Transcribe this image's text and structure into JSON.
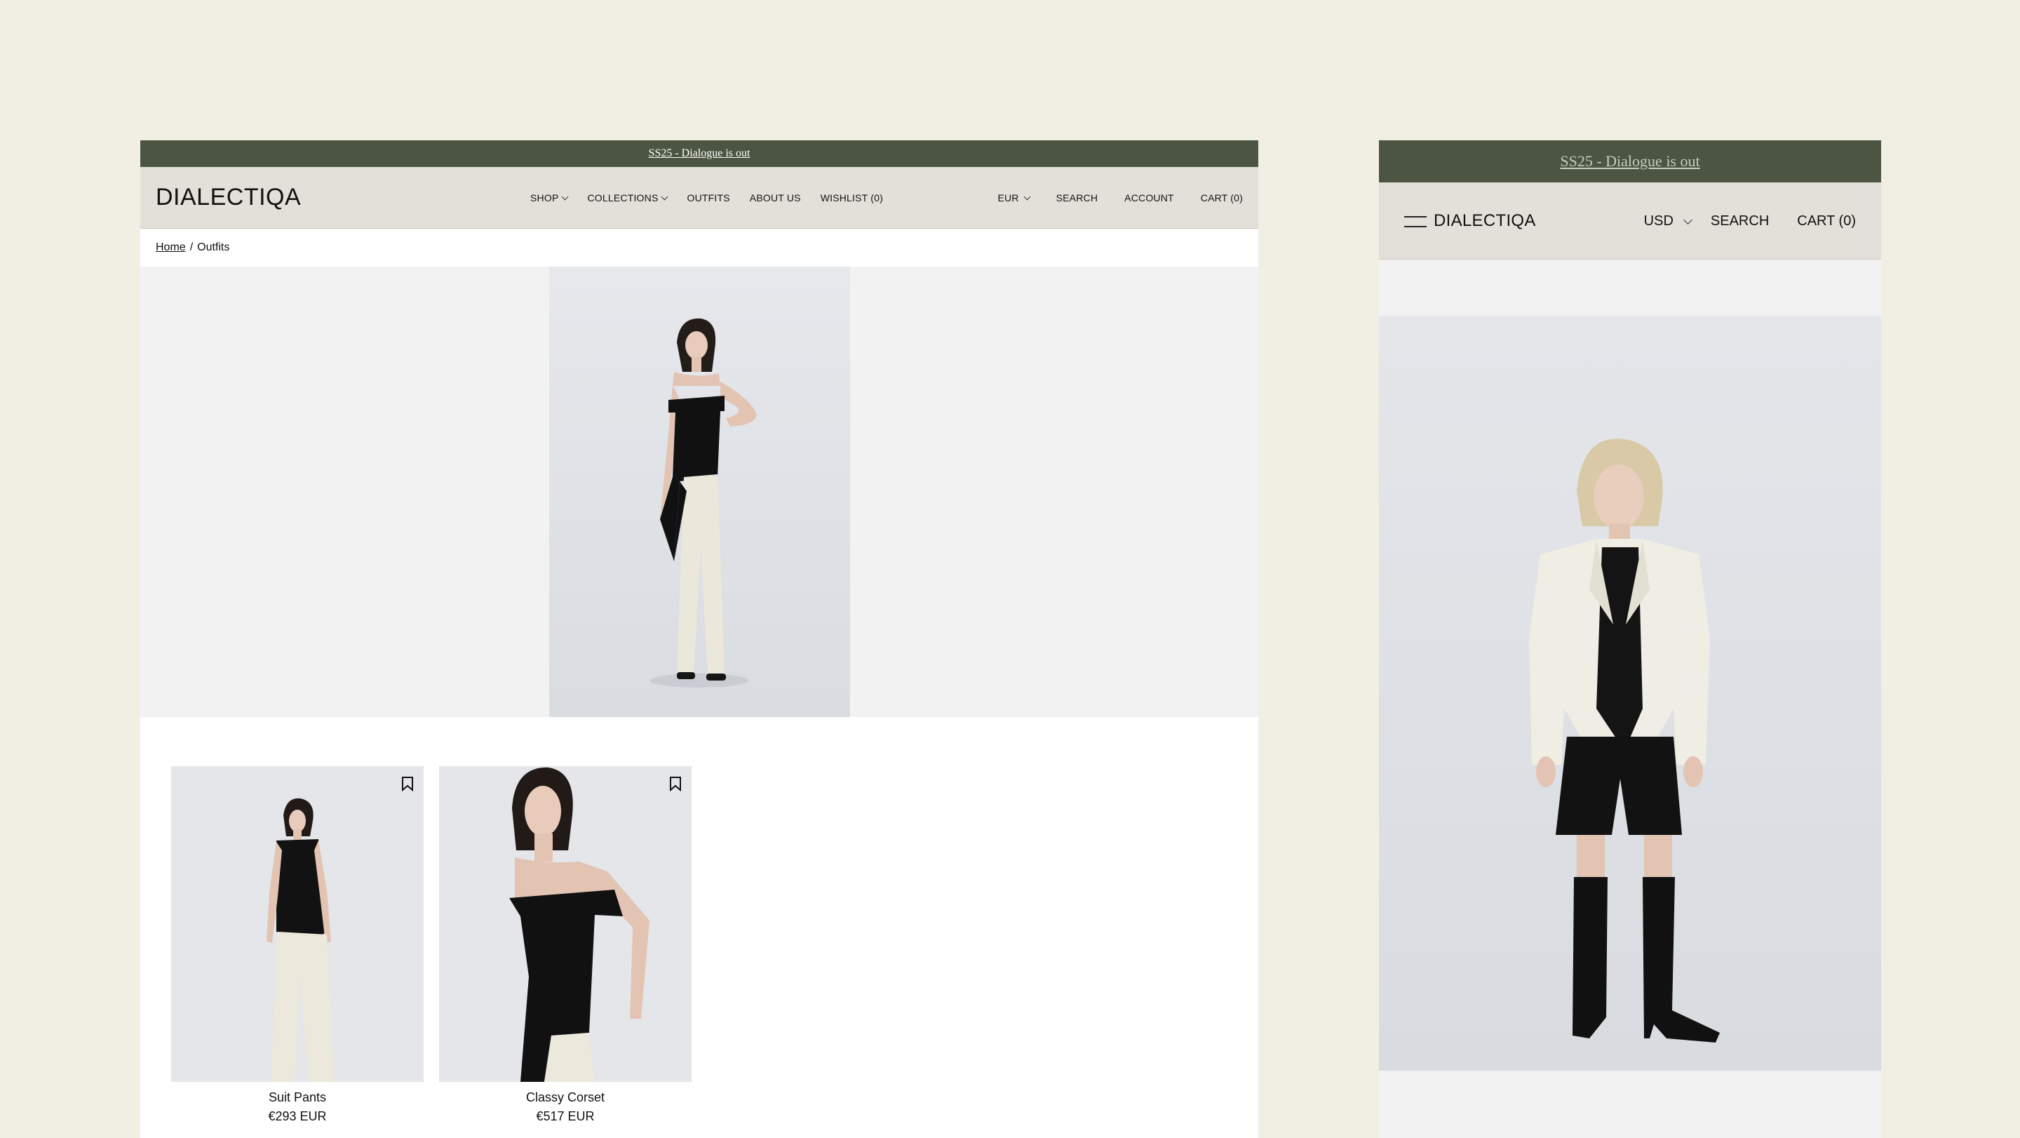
{
  "desktop": {
    "announcement": "SS25 - Dialogue is out",
    "logo": "DIALECTIQA",
    "nav": [
      {
        "label": "SHOP",
        "has_dropdown": true
      },
      {
        "label": "COLLECTIONS",
        "has_dropdown": true
      },
      {
        "label": "OUTFITS",
        "has_dropdown": false
      },
      {
        "label": "ABOUT US",
        "has_dropdown": false
      },
      {
        "label": "WISHLIST (0)",
        "has_dropdown": false
      }
    ],
    "currency": "EUR",
    "search": "SEARCH",
    "account": "ACCOUNT",
    "cart": "CART (0)",
    "breadcrumb": {
      "home": "Home",
      "separator": "/",
      "current": "Outfits"
    },
    "products": [
      {
        "name": "Suit Pants",
        "price": "€293 EUR",
        "icon": "bookmark-icon"
      },
      {
        "name": "Classy Corset",
        "price": "€517 EUR",
        "icon": "bookmark-icon"
      }
    ]
  },
  "mobile": {
    "announcement": "SS25 - Dialogue is out",
    "logo": "DIALECTIQA",
    "currency": "USD",
    "search": "SEARCH",
    "cart": "CART (0)",
    "menu_icon": "hamburger-icon"
  },
  "colors": {
    "page_bg": "#f1efe3",
    "announcement_bg": "#4b5541",
    "header_bg": "#e2e0d9",
    "hero_bg": "#f2f2f2"
  }
}
